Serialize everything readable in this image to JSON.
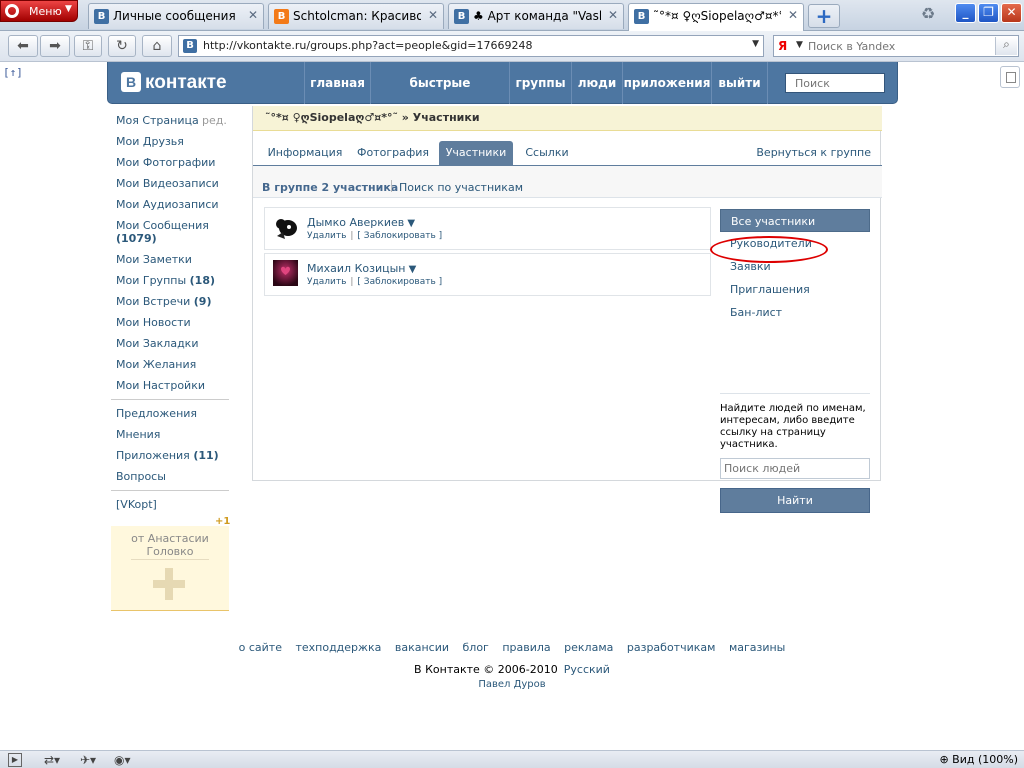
{
  "browser": {
    "menu_label": "Меню",
    "tabs": [
      {
        "title": "Личные сообщения | В ...",
        "favicon": "vk-icon",
        "fav_letter": "B",
        "active": false
      },
      {
        "title": "Schtolcman: Красиво о...",
        "favicon": "blogger-icon",
        "fav_letter": "B",
        "active": false
      },
      {
        "title": "♣ Арт команда \"Vashid...",
        "favicon": "vk-icon",
        "fav_letter": "B",
        "active": false
      },
      {
        "title": "˜°*¤ ♀ღЅiopelaღ♂¤*°˜:...",
        "favicon": "vk-icon",
        "fav_letter": "B",
        "active": true
      }
    ],
    "tab_close": "✕",
    "new_tab": "+",
    "url": "http://vkontakte.ru/groups.php?act=people&gid=17669248",
    "search_placeholder": "Поиск в Yandex",
    "search_engine": "Я",
    "zoom_label": "Вид (100%)"
  },
  "vk": {
    "logo_letter": "В",
    "logo_text": "контакте",
    "nav": [
      "главная",
      "быстрые сообщения",
      "группы",
      "люди",
      "приложения",
      "выйти"
    ],
    "search_placeholder": "Поиск",
    "up_link": "[↑]"
  },
  "left_menu": {
    "items": [
      {
        "label": "Моя Страница",
        "count": ""
      },
      {
        "label": "Мои Друзья",
        "count": ""
      },
      {
        "label": "Мои Фотографии",
        "count": ""
      },
      {
        "label": "Мои Видеозаписи",
        "count": ""
      },
      {
        "label": "Мои Аудиозаписи",
        "count": ""
      },
      {
        "label": "Мои Сообщения",
        "count": "(1079)"
      },
      {
        "label": "Мои Заметки",
        "count": ""
      },
      {
        "label": "Мои Группы",
        "count": "(18)"
      },
      {
        "label": "Мои Встречи",
        "count": "(9)"
      },
      {
        "label": "Мои Новости",
        "count": ""
      },
      {
        "label": "Мои Закладки",
        "count": ""
      },
      {
        "label": "Мои Желания",
        "count": ""
      },
      {
        "label": "Мои Настройки",
        "count": ""
      }
    ],
    "edit_label": "ред.",
    "extra_items": [
      {
        "label": "Предложения",
        "count": ""
      },
      {
        "label": "Мнения",
        "count": ""
      },
      {
        "label": "Приложения",
        "count": "(11)"
      },
      {
        "label": "Вопросы",
        "count": ""
      }
    ],
    "vkopt": "[VKopt]",
    "gift_plus": "+1",
    "gift_from": "от Анастасии Головко"
  },
  "group": {
    "breadcrumb_group": "˜°*¤ ♀ღЅiopelaღ♂¤*°˜",
    "breadcrumb_sep": " » ",
    "breadcrumb_page": "Участники",
    "tabs": [
      "Информация",
      "Фотография",
      "Участники",
      "Ссылки"
    ],
    "active_tab": "Участники",
    "back_link": "Вернуться к группе",
    "count_text": "В группе 2 участника",
    "search_members": "Поиск по участникам",
    "members": [
      {
        "name": "Дымко Аверкиев",
        "remove": "Удалить",
        "block": "[ Заблокировать ]"
      },
      {
        "name": "Михаил Козицын",
        "remove": "Удалить",
        "block": "[ Заблокировать ]"
      }
    ],
    "filters": [
      "Все участники",
      "Руководители",
      "Заявки",
      "Приглашения",
      "Бан-лист"
    ],
    "active_filter": "Все участники",
    "hint": "Найдите людей по именам, интересам, либо введите ссылку на страницу участника.",
    "people_search_placeholder": "Поиск людей",
    "find_button": "Найти"
  },
  "footer": {
    "links": [
      "о сайте",
      "техподдержка",
      "вакансии",
      "блог",
      "правила",
      "реклама",
      "разработчикам",
      "магазины"
    ],
    "copyright": "В Контакте © 2006-2010",
    "language": "Русский",
    "author": "Павел Дуров"
  },
  "colors": {
    "vk_blue": "#4d76a1",
    "tab_active": "#5f7d9d",
    "link": "#2b587a",
    "highlight_oval": "#dd0000"
  }
}
